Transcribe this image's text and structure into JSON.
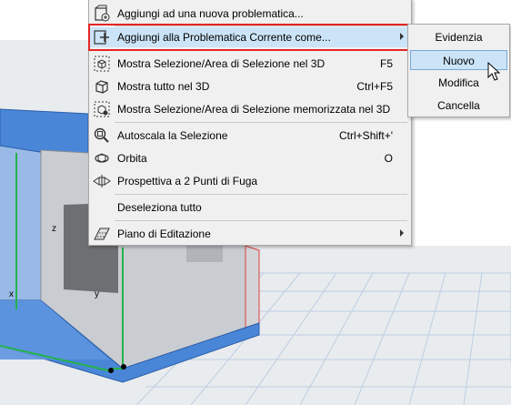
{
  "colors": {
    "menu_bg": "#f0f0f0",
    "highlight": "#cce4f7",
    "red_frame": "#e52525",
    "blue_slab": "#4a86d8"
  },
  "menu": {
    "items": [
      {
        "label": "Aggiungi ad una nuova problematica...",
        "shortcut": "",
        "icon": "add-issue-icon"
      },
      {
        "label": "Aggiungi alla Problematica Corrente come...",
        "shortcut": "",
        "icon": "add-to-issue-icon"
      },
      {
        "label": "Mostra Selezione/Area di Selezione nel 3D",
        "shortcut": "F5",
        "icon": "show-selection-3d-icon"
      },
      {
        "label": "Mostra tutto nel 3D",
        "shortcut": "Ctrl+F5",
        "icon": "show-all-3d-icon"
      },
      {
        "label": "Mostra Selezione/Area di Selezione memorizzata nel 3D",
        "shortcut": "",
        "icon": "show-stored-selection-3d-icon"
      },
      {
        "label": "Autoscala la Selezione",
        "shortcut": "Ctrl+Shift+'",
        "icon": "zoom-to-selection-icon"
      },
      {
        "label": "Orbita",
        "shortcut": "O",
        "icon": "orbit-icon"
      },
      {
        "label": "Prospettiva a 2 Punti di Fuga",
        "shortcut": "",
        "icon": "two-point-perspective-icon"
      },
      {
        "label": "Deseleziona tutto",
        "shortcut": "",
        "icon": ""
      },
      {
        "label": "Piano di Editazione",
        "shortcut": "",
        "icon": "editing-plane-icon"
      }
    ]
  },
  "submenu": {
    "items": [
      "Evidenzia",
      "Nuovo",
      "Modifica",
      "Cancella"
    ]
  },
  "axes": {
    "x": "x",
    "y": "y",
    "z": "z"
  }
}
